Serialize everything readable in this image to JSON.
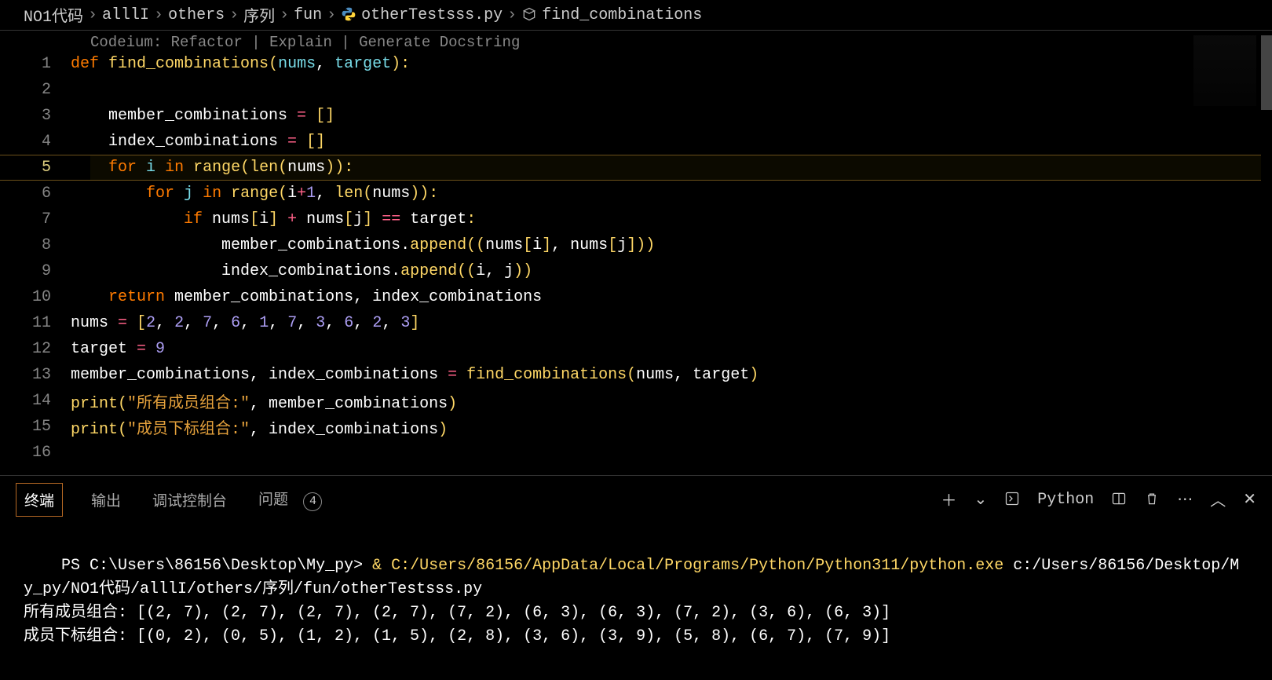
{
  "breadcrumb": {
    "items": [
      "NO1代码",
      "alllI",
      "others",
      "序列",
      "fun",
      "otherTestsss.py",
      "find_combinations"
    ]
  },
  "codelens": {
    "prefix": "Codeium: ",
    "refactor": "Refactor",
    "explain": "Explain",
    "docstring": "Generate Docstring"
  },
  "code": {
    "lines": [
      {
        "n": 1,
        "tokens": [
          [
            "kw",
            "def "
          ],
          [
            "fn",
            "find_combinations"
          ],
          [
            "pn",
            "("
          ],
          [
            "param",
            "nums"
          ],
          [
            "wht",
            ", "
          ],
          [
            "param",
            "target"
          ],
          [
            "pn",
            "):"
          ]
        ]
      },
      {
        "n": 2,
        "tokens": []
      },
      {
        "n": 3,
        "indent": 1,
        "tokens": [
          [
            "wht",
            "    member_combinations "
          ],
          [
            "op",
            "="
          ],
          [
            "wht",
            " "
          ],
          [
            "pn",
            "[]"
          ]
        ]
      },
      {
        "n": 4,
        "indent": 1,
        "tokens": [
          [
            "wht",
            "    index_combinations "
          ],
          [
            "op",
            "="
          ],
          [
            "wht",
            " "
          ],
          [
            "pn",
            "[]"
          ]
        ]
      },
      {
        "n": 5,
        "hl": true,
        "indent": 1,
        "tokens": [
          [
            "wht",
            "    "
          ],
          [
            "kw",
            "for"
          ],
          [
            "wht",
            " "
          ],
          [
            "param",
            "i"
          ],
          [
            "wht",
            " "
          ],
          [
            "kw",
            "in"
          ],
          [
            "wht",
            " "
          ],
          [
            "call",
            "range"
          ],
          [
            "pn",
            "("
          ],
          [
            "call",
            "len"
          ],
          [
            "pn",
            "("
          ],
          [
            "wht",
            "nums"
          ],
          [
            "pn",
            ")):"
          ]
        ]
      },
      {
        "n": 6,
        "indent": 2,
        "tokens": [
          [
            "wht",
            "        "
          ],
          [
            "kw",
            "for"
          ],
          [
            "wht",
            " "
          ],
          [
            "param",
            "j"
          ],
          [
            "wht",
            " "
          ],
          [
            "kw",
            "in"
          ],
          [
            "wht",
            " "
          ],
          [
            "call",
            "range"
          ],
          [
            "pn",
            "("
          ],
          [
            "wht",
            "i"
          ],
          [
            "op",
            "+"
          ],
          [
            "num",
            "1"
          ],
          [
            "wht",
            ", "
          ],
          [
            "call",
            "len"
          ],
          [
            "pn",
            "("
          ],
          [
            "wht",
            "nums"
          ],
          [
            "pn",
            ")):"
          ]
        ]
      },
      {
        "n": 7,
        "indent": 3,
        "tokens": [
          [
            "wht",
            "            "
          ],
          [
            "kw",
            "if"
          ],
          [
            "wht",
            " nums"
          ],
          [
            "pn",
            "["
          ],
          [
            "wht",
            "i"
          ],
          [
            "pn",
            "]"
          ],
          [
            "wht",
            " "
          ],
          [
            "op",
            "+"
          ],
          [
            "wht",
            " nums"
          ],
          [
            "pn",
            "["
          ],
          [
            "wht",
            "j"
          ],
          [
            "pn",
            "]"
          ],
          [
            "wht",
            " "
          ],
          [
            "op",
            "=="
          ],
          [
            "wht",
            " target"
          ],
          [
            "pn",
            ":"
          ]
        ]
      },
      {
        "n": 8,
        "indent": 4,
        "tokens": [
          [
            "wht",
            "                member_combinations."
          ],
          [
            "call",
            "append"
          ],
          [
            "pn",
            "(("
          ],
          [
            "wht",
            "nums"
          ],
          [
            "pn",
            "["
          ],
          [
            "wht",
            "i"
          ],
          [
            "pn",
            "]"
          ],
          [
            "wht",
            ", nums"
          ],
          [
            "pn",
            "["
          ],
          [
            "wht",
            "j"
          ],
          [
            "pn",
            "]))"
          ]
        ]
      },
      {
        "n": 9,
        "indent": 4,
        "tokens": [
          [
            "wht",
            "                index_combinations."
          ],
          [
            "call",
            "append"
          ],
          [
            "pn",
            "(("
          ],
          [
            "wht",
            "i, j"
          ],
          [
            "pn",
            "))"
          ]
        ]
      },
      {
        "n": 10,
        "indent": 1,
        "tokens": [
          [
            "wht",
            "    "
          ],
          [
            "kw",
            "return"
          ],
          [
            "wht",
            " member_combinations, index_combinations"
          ]
        ]
      },
      {
        "n": 11,
        "tokens": [
          [
            "wht",
            "nums "
          ],
          [
            "op",
            "="
          ],
          [
            "wht",
            " "
          ],
          [
            "pn",
            "["
          ],
          [
            "num",
            "2"
          ],
          [
            "wht",
            ", "
          ],
          [
            "num",
            "2"
          ],
          [
            "wht",
            ", "
          ],
          [
            "num",
            "7"
          ],
          [
            "wht",
            ", "
          ],
          [
            "num",
            "6"
          ],
          [
            "wht",
            ", "
          ],
          [
            "num",
            "1"
          ],
          [
            "wht",
            ", "
          ],
          [
            "num",
            "7"
          ],
          [
            "wht",
            ", "
          ],
          [
            "num",
            "3"
          ],
          [
            "wht",
            ", "
          ],
          [
            "num",
            "6"
          ],
          [
            "wht",
            ", "
          ],
          [
            "num",
            "2"
          ],
          [
            "wht",
            ", "
          ],
          [
            "num",
            "3"
          ],
          [
            "pn",
            "]"
          ]
        ]
      },
      {
        "n": 12,
        "tokens": [
          [
            "wht",
            "target "
          ],
          [
            "op",
            "="
          ],
          [
            "wht",
            " "
          ],
          [
            "num",
            "9"
          ]
        ]
      },
      {
        "n": 13,
        "tokens": [
          [
            "wht",
            "member_combinations, index_combinations "
          ],
          [
            "op",
            "="
          ],
          [
            "wht",
            " "
          ],
          [
            "call",
            "find_combinations"
          ],
          [
            "pn",
            "("
          ],
          [
            "wht",
            "nums, target"
          ],
          [
            "pn",
            ")"
          ]
        ]
      },
      {
        "n": 14,
        "tokens": [
          [
            "call",
            "print"
          ],
          [
            "pn",
            "("
          ],
          [
            "str",
            "\"所有成员组合:\""
          ],
          [
            "wht",
            ", member_combinations"
          ],
          [
            "pn",
            ")"
          ]
        ]
      },
      {
        "n": 15,
        "tokens": [
          [
            "call",
            "print"
          ],
          [
            "pn",
            "("
          ],
          [
            "str",
            "\"成员下标组合:\""
          ],
          [
            "wht",
            ", index_combinations"
          ],
          [
            "pn",
            ")"
          ]
        ]
      },
      {
        "n": 16,
        "tokens": []
      }
    ]
  },
  "panel": {
    "tabs": {
      "terminal": "终端",
      "output": "输出",
      "debug": "调试控制台",
      "problems": "问题",
      "problems_count": "4"
    },
    "shell_label": "Python"
  },
  "terminal": {
    "prompt": "PS C:\\Users\\86156\\Desktop\\My_py> ",
    "amp": "& ",
    "exe": "C:/Users/86156/AppData/Local/Programs/Python/Python311/python.exe",
    "script": " c:/Users/86156/Desktop/My_py/NO1代码/alllI/others/序列/fun/otherTestsss.py",
    "out1": "所有成员组合: [(2, 7), (2, 7), (2, 7), (2, 7), (7, 2), (6, 3), (6, 3), (7, 2), (3, 6), (6, 3)]",
    "out2": "成员下标组合: [(0, 2), (0, 5), (1, 2), (1, 5), (2, 8), (3, 6), (3, 9), (5, 8), (6, 7), (7, 9)]"
  }
}
